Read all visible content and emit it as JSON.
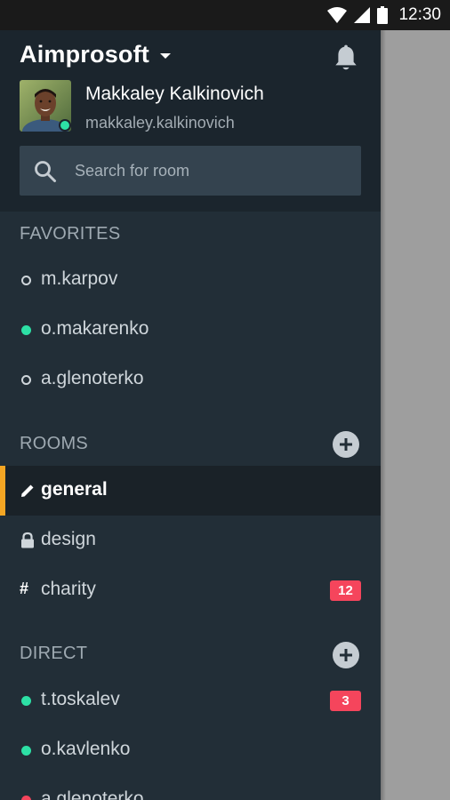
{
  "status_bar": {
    "time": "12:30"
  },
  "header": {
    "org_name": "Aimprosoft",
    "user": {
      "name": "Makkaley Kalkinovich",
      "handle": "makkaley.kalkinovich"
    }
  },
  "search": {
    "placeholder": "Search for room",
    "value": ""
  },
  "favorites": {
    "title": "FAVORITES",
    "items": [
      {
        "label": "m.karpov",
        "status": "offline"
      },
      {
        "label": "o.makarenko",
        "status": "online"
      },
      {
        "label": "a.glenoterko",
        "status": "offline"
      }
    ]
  },
  "rooms": {
    "title": "ROOMS",
    "items": [
      {
        "label": "general",
        "icon": "pencil-icon",
        "active": true
      },
      {
        "label": "design",
        "icon": "lock-icon"
      },
      {
        "label": "charity",
        "icon": "hash-icon",
        "badge": "12"
      }
    ]
  },
  "direct": {
    "title": "DIRECT",
    "items": [
      {
        "label": "t.toskalev",
        "status": "online",
        "badge": "3"
      },
      {
        "label": "o.kavlenko",
        "status": "online"
      },
      {
        "label": "a.glenoterko",
        "status": "busy"
      }
    ]
  },
  "colors": {
    "drawer_bg": "#222e37",
    "header_bg": "#1b252d",
    "accent_active": "#f5a623",
    "online": "#2de0a5",
    "busy": "#f5455c",
    "badge": "#f5455c"
  }
}
